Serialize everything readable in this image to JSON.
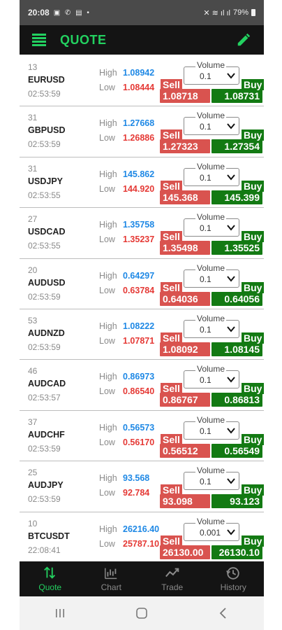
{
  "status": {
    "time": "20:08",
    "left_icons": "▣ ✆ ▤ •",
    "right_icons": "✕ ≋ ıl ıl",
    "battery": "79%"
  },
  "appbar": {
    "title": "QUOTE",
    "menu_icon": "menu-icon",
    "edit_icon": "pencil-icon"
  },
  "labels": {
    "high": "High",
    "low": "Low",
    "volume": "Volume",
    "sell": "Sell",
    "buy": "Buy"
  },
  "quotes": [
    {
      "num": "13",
      "symbol": "EURUSD",
      "time": "02:53:59",
      "high": "1.08942",
      "low": "1.08444",
      "volume": "0.1",
      "sell": "1.08718",
      "buy": "1.08731"
    },
    {
      "num": "31",
      "symbol": "GBPUSD",
      "time": "02:53:59",
      "high": "1.27668",
      "low": "1.26886",
      "volume": "0.1",
      "sell": "1.27323",
      "buy": "1.27354"
    },
    {
      "num": "31",
      "symbol": "USDJPY",
      "time": "02:53:55",
      "high": "145.862",
      "low": "144.920",
      "volume": "0.1",
      "sell": "145.368",
      "buy": "145.399"
    },
    {
      "num": "27",
      "symbol": "USDCAD",
      "time": "02:53:55",
      "high": "1.35758",
      "low": "1.35237",
      "volume": "0.1",
      "sell": "1.35498",
      "buy": "1.35525"
    },
    {
      "num": "20",
      "symbol": "AUDUSD",
      "time": "02:53:59",
      "high": "0.64297",
      "low": "0.63784",
      "volume": "0.1",
      "sell": "0.64036",
      "buy": "0.64056"
    },
    {
      "num": "53",
      "symbol": "AUDNZD",
      "time": "02:53:59",
      "high": "1.08222",
      "low": "1.07871",
      "volume": "0.1",
      "sell": "1.08092",
      "buy": "1.08145"
    },
    {
      "num": "46",
      "symbol": "AUDCAD",
      "time": "02:53:57",
      "high": "0.86973",
      "low": "0.86540",
      "volume": "0.1",
      "sell": "0.86767",
      "buy": "0.86813"
    },
    {
      "num": "37",
      "symbol": "AUDCHF",
      "time": "02:53:59",
      "high": "0.56573",
      "low": "0.56170",
      "volume": "0.1",
      "sell": "0.56512",
      "buy": "0.56549"
    },
    {
      "num": "25",
      "symbol": "AUDJPY",
      "time": "02:53:59",
      "high": "93.568",
      "low": "92.784",
      "volume": "0.1",
      "sell": "93.098",
      "buy": "93.123"
    },
    {
      "num": "10",
      "symbol": "BTCUSDT",
      "time": "22:08:41",
      "high": "26216.40",
      "low": "25787.10",
      "volume": "0.001",
      "sell": "26130.00",
      "buy": "26130.10"
    }
  ],
  "nav": [
    {
      "label": "Quote",
      "icon": "quote-arrows-icon",
      "active": true
    },
    {
      "label": "Chart",
      "icon": "chart-icon",
      "active": false
    },
    {
      "label": "Trade",
      "icon": "trade-trend-icon",
      "active": false
    },
    {
      "label": "History",
      "icon": "history-clock-icon",
      "active": false
    }
  ],
  "colors": {
    "accent": "#23d160",
    "high": "#1e88e5",
    "low": "#e53935",
    "sell": "#d9534f",
    "buy": "#137a13"
  }
}
